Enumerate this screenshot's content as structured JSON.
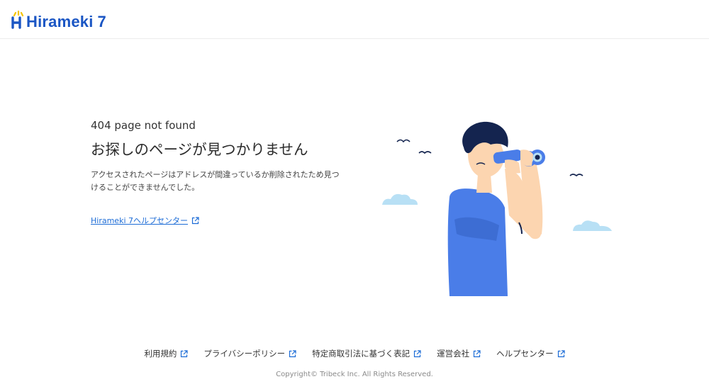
{
  "header": {
    "logo_text": "Hirameki",
    "logo_number": "7"
  },
  "main": {
    "code": "404 page not found",
    "title": "お探しのページが見つかりません",
    "description": "アクセスされたページはアドレスが間違っているか削除されたため見つけることができませんでした。",
    "help_link": "Hirameki 7ヘルプセンター"
  },
  "footer": {
    "links": [
      {
        "label": "利用規約"
      },
      {
        "label": "プライバシーポリシー"
      },
      {
        "label": "特定商取引法に基づく表記"
      },
      {
        "label": "運営会社"
      },
      {
        "label": "ヘルプセンター"
      }
    ],
    "copyright": "Copyright© Tribeck Inc. All Rights Reserved."
  },
  "colors": {
    "brand": "#1b56c4",
    "link": "#1b6bd6",
    "shirt": "#4a7de8",
    "hair": "#14244f",
    "skin": "#fcd5b0",
    "cloud": "#b8e0f5",
    "accent_yellow": "#f5c400"
  },
  "icons": {
    "external_link": "external-link-icon",
    "logo": "hirameki-logo-icon"
  }
}
